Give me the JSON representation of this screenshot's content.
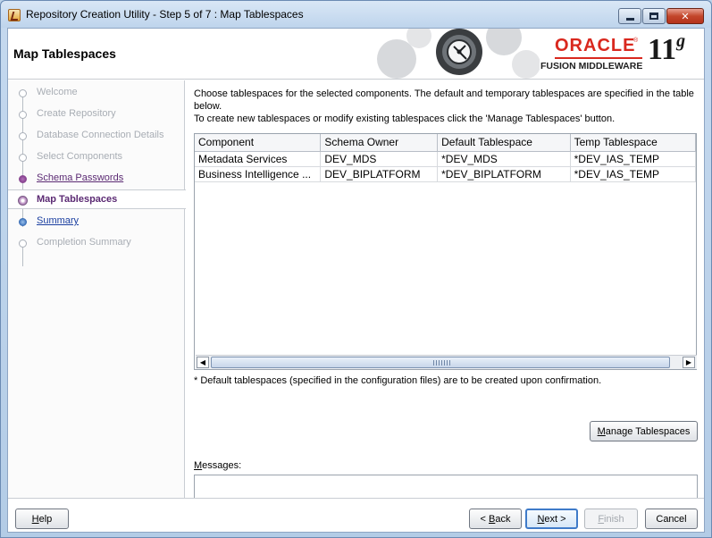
{
  "window": {
    "title": "Repository Creation Utility - Step 5 of 7 : Map Tablespaces",
    "icon": "java-app-icon"
  },
  "header": {
    "heading": "Map Tablespaces",
    "brand": {
      "oracle": "ORACLE",
      "product": "FUSION MIDDLEWARE",
      "version": "11",
      "version_suffix": "g"
    }
  },
  "nav": {
    "items": [
      {
        "label": "Welcome",
        "state": "visited"
      },
      {
        "label": "Create Repository",
        "state": "visited"
      },
      {
        "label": "Database Connection Details",
        "state": "visited"
      },
      {
        "label": "Select Components",
        "state": "visited"
      },
      {
        "label": "Schema Passwords",
        "state": "link"
      },
      {
        "label": "Map Tablespaces",
        "state": "current"
      },
      {
        "label": "Summary",
        "state": "next"
      },
      {
        "label": "Completion Summary",
        "state": "disabled"
      }
    ]
  },
  "main": {
    "instructions": [
      "Choose tablespaces for the selected components. The default and temporary tablespaces are specified in the table below.",
      "To create new tablespaces or modify existing tablespaces click the 'Manage Tablespaces' button."
    ],
    "table": {
      "headers": [
        "Component",
        "Schema Owner",
        "Default Tablespace",
        "Temp Tablespace"
      ],
      "rows": [
        [
          "Metadata Services",
          "DEV_MDS",
          "*DEV_MDS",
          "*DEV_IAS_TEMP"
        ],
        [
          "Business Intelligence ...",
          "DEV_BIPLATFORM",
          "*DEV_BIPLATFORM",
          "*DEV_IAS_TEMP"
        ]
      ]
    },
    "footnote": "* Default tablespaces (specified in the configuration files) are to be created upon confirmation.",
    "manage_button": {
      "mnemonic": "M",
      "rest": "anage Tablespaces"
    },
    "messages_label": {
      "mnemonic": "M",
      "rest": "essages:"
    }
  },
  "buttons": {
    "help": {
      "mnemonic": "H",
      "rest": "elp"
    },
    "back": {
      "prefix": "< ",
      "mnemonic": "B",
      "rest": "ack"
    },
    "next": {
      "mnemonic": "N",
      "rest": "ext >"
    },
    "finish": {
      "mnemonic": "F",
      "rest": "inish"
    },
    "cancel": "Cancel"
  }
}
